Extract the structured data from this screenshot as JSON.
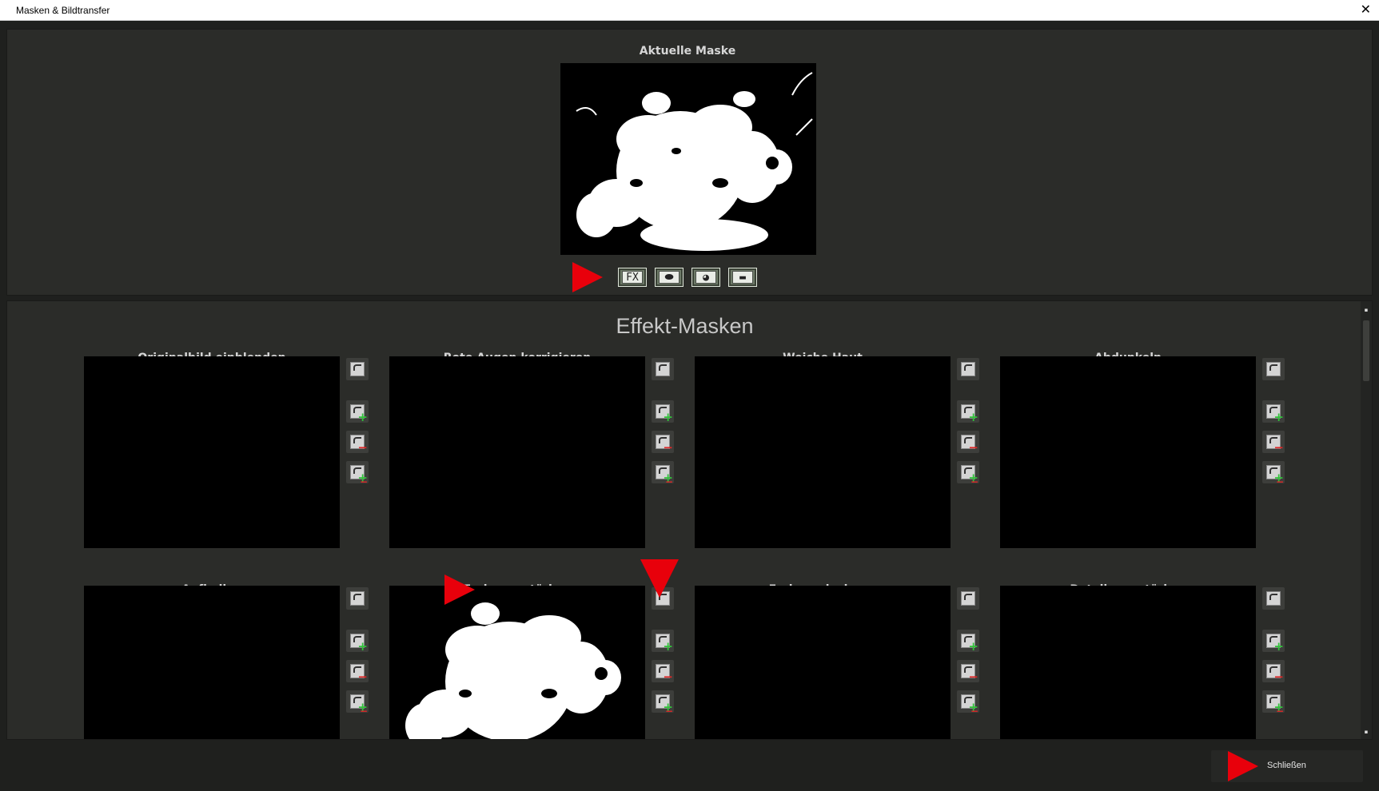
{
  "window": {
    "title": "Masken & Bildtransfer",
    "close_glyph": "✕"
  },
  "current_mask": {
    "label": "Aktuelle Maske",
    "toolbar": [
      {
        "name": "fx-mask-button",
        "glyph": "FX"
      },
      {
        "name": "oval-mask-button",
        "glyph": "⬬"
      },
      {
        "name": "color-mask-button",
        "glyph": "◕"
      },
      {
        "name": "gradient-mask-button",
        "glyph": "▬"
      }
    ]
  },
  "effect_masks": {
    "heading": "Effekt-Masken",
    "cells": [
      {
        "label": "Originalbild einblenden",
        "has_mask": false
      },
      {
        "label": "Rote Augen korrigieren",
        "has_mask": false
      },
      {
        "label": "Weiche Haut",
        "has_mask": false
      },
      {
        "label": "Abdunkeln",
        "has_mask": false
      },
      {
        "label": "Aufhellen",
        "has_mask": false
      },
      {
        "label": "Farbe verstärken",
        "has_mask": true
      },
      {
        "label": "Farbe reduzieren",
        "has_mask": false
      },
      {
        "label": "Details verstärken",
        "has_mask": false
      }
    ]
  },
  "footer": {
    "close_label": "Schließen"
  },
  "colors": {
    "accent_arrow": "#e8000b",
    "plus": "#31c23a",
    "minus": "#e02626"
  },
  "icons": [
    "apply-mask-icon",
    "add-mask-icon",
    "subtract-mask-icon",
    "intersect-mask-icon",
    "play-arrow-icon"
  ]
}
